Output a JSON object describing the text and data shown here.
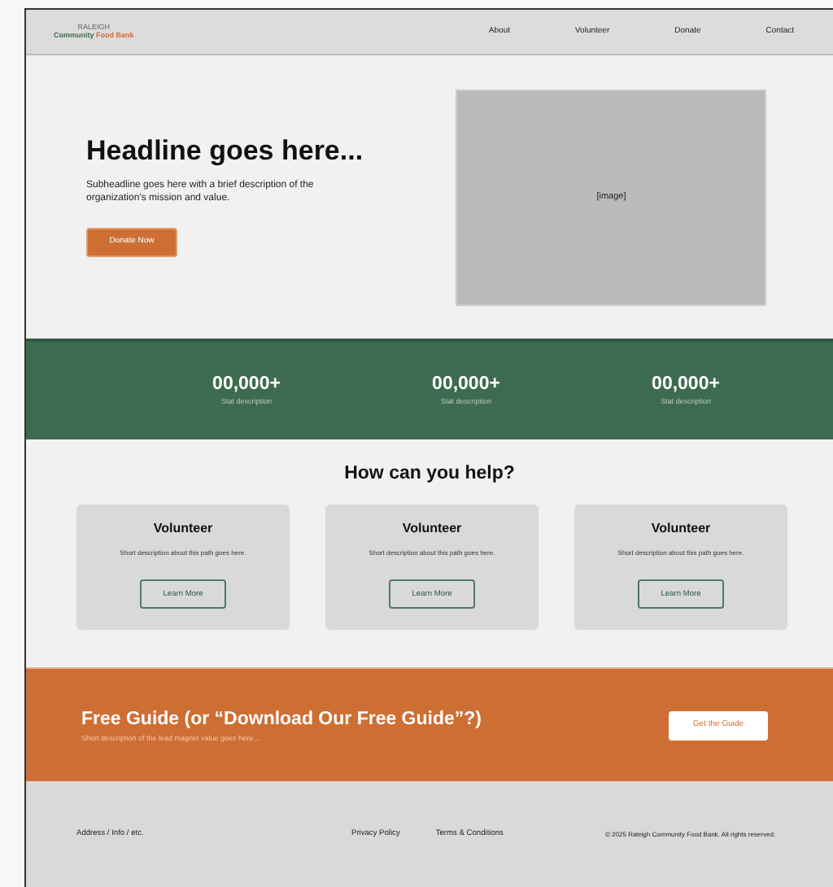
{
  "header": {
    "logo": {
      "tagline": "RALEIGH",
      "name_primary": "Community",
      "name_accent": "Food Bank"
    },
    "nav": [
      "About",
      "Volunteer",
      "Donate",
      "Contact"
    ]
  },
  "hero": {
    "headline": "Headline goes here...",
    "subheadline": "Subheadline goes here with a brief description of the organization's mission and value.",
    "button": "Donate Now",
    "image_label": "[image]"
  },
  "stats": [
    {
      "value": "00,000+",
      "description": "Stat description"
    },
    {
      "value": "00,000+",
      "description": "Stat description"
    },
    {
      "value": "00,000+",
      "description": "Stat description"
    }
  ],
  "help": {
    "title": "How can you help?",
    "cards": [
      {
        "title": "Volunteer",
        "description": "Short description about this path goes here.",
        "button": "Learn More"
      },
      {
        "title": "Volunteer",
        "description": "Short description about this path goes here.",
        "button": "Learn More"
      },
      {
        "title": "Volunteer",
        "description": "Short description about this path goes here.",
        "button": "Learn More"
      }
    ]
  },
  "lead_magnet": {
    "title": "Free Guide (or “Download Our Free Guide”?)",
    "description": "Short description of the lead magnet value goes here...",
    "button": "Get the Guide"
  },
  "footer": {
    "address": "Address / Info / etc.",
    "links": [
      "Privacy Policy",
      "Terms & Conditions"
    ],
    "copyright": "© 2025 Raleigh Community Food Bank. All rights reserved."
  }
}
